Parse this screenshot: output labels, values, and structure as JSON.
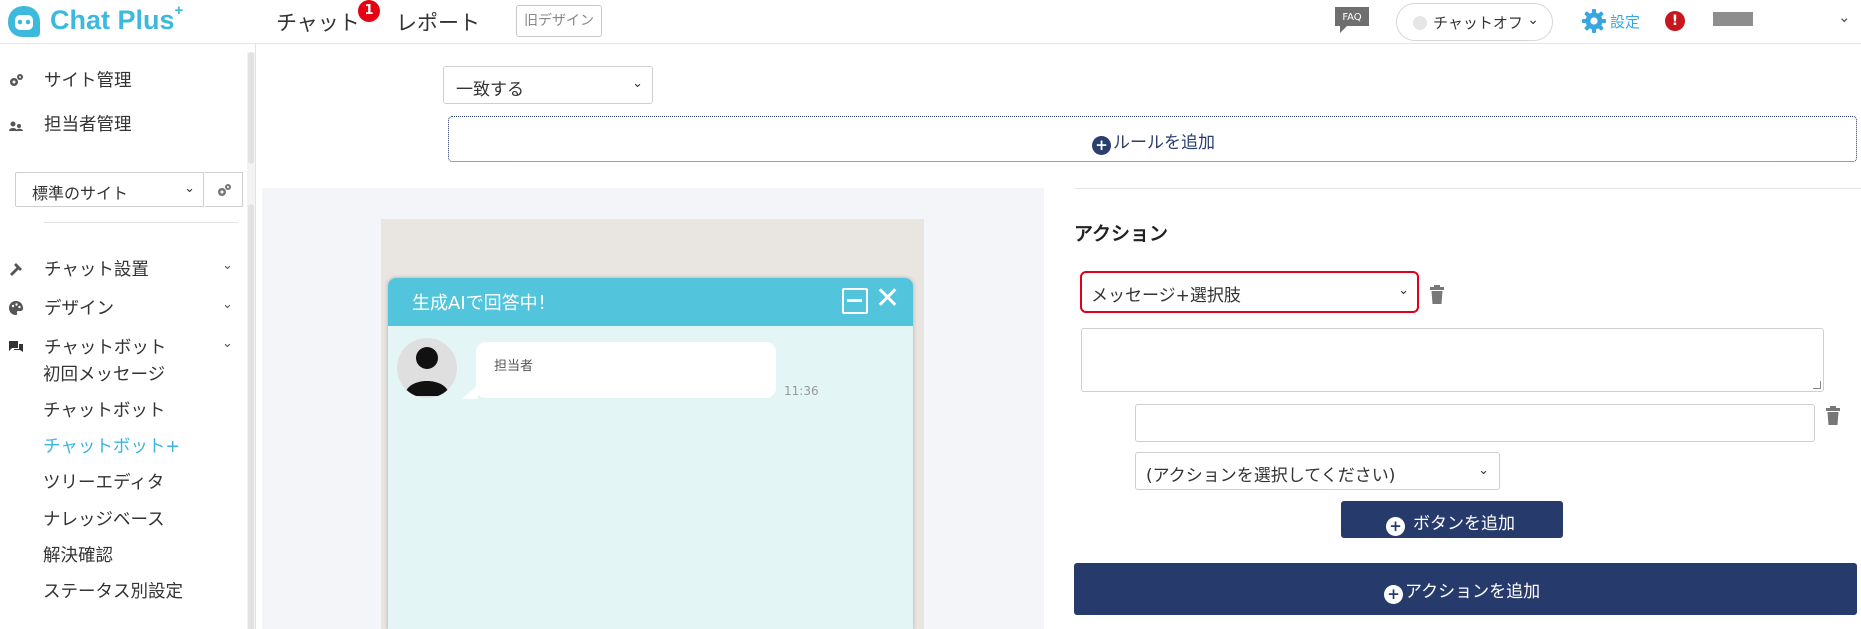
{
  "header": {
    "logo_text": "Chat Plus",
    "logo_sup": "+",
    "nav": [
      {
        "label": "チャット",
        "badge": "1"
      },
      {
        "label": "レポート"
      }
    ],
    "old_design_label": "旧デザイン",
    "faq_label": "FAQ",
    "chat_status_label": "チャットオフ",
    "settings_label": "設定",
    "alert_symbol": "!",
    "user_menu_chevron": "⌄"
  },
  "sidebar": {
    "top_items": [
      {
        "label": "サイト管理",
        "icon": "gears-icon"
      },
      {
        "label": "担当者管理",
        "icon": "users-icon"
      }
    ],
    "site_select_value": "標準のサイト",
    "sections": [
      {
        "label": "チャット設置",
        "icon": "tools-icon"
      },
      {
        "label": "デザイン",
        "icon": "palette-icon"
      },
      {
        "label": "チャットボット",
        "icon": "chat-bubbles-icon"
      }
    ],
    "chatbot_sub_items": [
      {
        "label": "初回メッセージ",
        "active": false
      },
      {
        "label": "チャットボット",
        "active": false
      },
      {
        "label": "チャットボット+",
        "active": true
      },
      {
        "label": "ツリーエディタ",
        "active": false
      },
      {
        "label": "ナレッジベース",
        "active": false
      },
      {
        "label": "解決確認",
        "active": false
      },
      {
        "label": "ステータス別設定",
        "active": false
      }
    ]
  },
  "rule": {
    "match_select_value": "一致する",
    "add_rule_label": "ルールを追加"
  },
  "preview": {
    "header_title": "生成AIで回答中！",
    "message_sender": "担当者",
    "message_time": "11:36"
  },
  "action": {
    "title": "アクション",
    "type_select_value": "メッセージ+選択肢",
    "choice_action_placeholder": "(アクションを選択してください)",
    "add_button_label": "ボタンを追加",
    "add_action_label": "アクションを追加"
  },
  "colors": {
    "brand": "#3db9de",
    "navy": "#273a6c",
    "highlight_red": "#e0001b",
    "active_link": "#3bb4e5",
    "chat_header": "#52c4db"
  }
}
